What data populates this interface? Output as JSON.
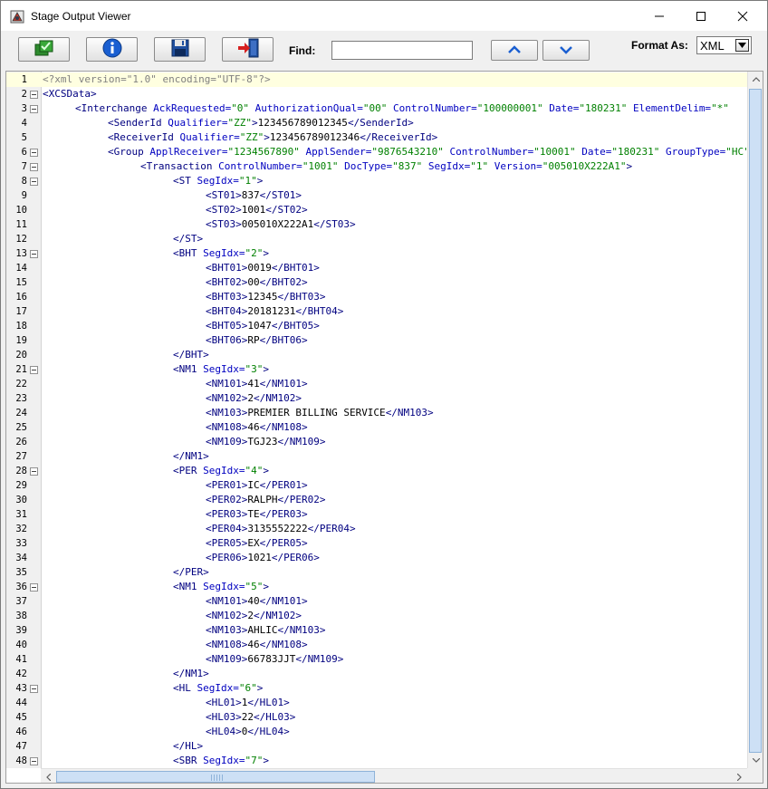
{
  "window": {
    "title": "Stage Output Viewer",
    "icon": "app-icon",
    "controls": [
      "minimize-icon",
      "maximize-icon",
      "close-icon"
    ]
  },
  "toolbar": {
    "buttons": [
      "checkmark-icon",
      "info-icon",
      "save-icon",
      "exit-door-icon"
    ],
    "find_label": "Find:",
    "find_value": "",
    "nav": [
      "up-chevron-icon",
      "down-chevron-icon"
    ],
    "format_label": "Format As:",
    "format_value": "XML"
  },
  "colors": {
    "tag": "#000080",
    "attr": "#0000c0",
    "value": "#008000",
    "decl": "#808080",
    "highlight_line": "#ffffe0",
    "thumb": "#cde0f5"
  },
  "editor": {
    "lines": [
      {
        "n": "1",
        "i": 0,
        "f": false,
        "s": [
          [
            "d",
            "<?xml version=\"1.0\" encoding=\"UTF-8\"?>"
          ]
        ]
      },
      {
        "n": "2",
        "i": 0,
        "f": true,
        "s": [
          [
            "t",
            "<XCSData>"
          ]
        ]
      },
      {
        "n": "3",
        "i": 1,
        "f": true,
        "s": [
          [
            "t",
            "<Interchange "
          ],
          [
            "a",
            "AckRequested="
          ],
          [
            "v",
            "\"0\""
          ],
          [
            "a",
            " AuthorizationQual="
          ],
          [
            "v",
            "\"00\""
          ],
          [
            "a",
            " ControlNumber="
          ],
          [
            "v",
            "\"100000001\""
          ],
          [
            "a",
            " Date="
          ],
          [
            "v",
            "\"180231\""
          ],
          [
            "a",
            " ElementDelim="
          ],
          [
            "v",
            "\"*\""
          ]
        ]
      },
      {
        "n": "4",
        "i": 2,
        "f": false,
        "s": [
          [
            "t",
            "<SenderId "
          ],
          [
            "a",
            "Qualifier="
          ],
          [
            "v",
            "\"ZZ\""
          ],
          [
            "t",
            ">"
          ],
          [
            "x",
            "123456789012345"
          ],
          [
            "t",
            "</SenderId>"
          ]
        ]
      },
      {
        "n": "5",
        "i": 2,
        "f": false,
        "s": [
          [
            "t",
            "<ReceiverId "
          ],
          [
            "a",
            "Qualifier="
          ],
          [
            "v",
            "\"ZZ\""
          ],
          [
            "t",
            ">"
          ],
          [
            "x",
            "123456789012346"
          ],
          [
            "t",
            "</ReceiverId>"
          ]
        ]
      },
      {
        "n": "6",
        "i": 2,
        "f": true,
        "s": [
          [
            "t",
            "<Group "
          ],
          [
            "a",
            "ApplReceiver="
          ],
          [
            "v",
            "\"1234567890\""
          ],
          [
            "a",
            " ApplSender="
          ],
          [
            "v",
            "\"9876543210\""
          ],
          [
            "a",
            " ControlNumber="
          ],
          [
            "v",
            "\"10001\""
          ],
          [
            "a",
            " Date="
          ],
          [
            "v",
            "\"180231\""
          ],
          [
            "a",
            " GroupType="
          ],
          [
            "v",
            "\"HC\""
          ]
        ]
      },
      {
        "n": "7",
        "i": 3,
        "f": true,
        "s": [
          [
            "t",
            "<Transaction "
          ],
          [
            "a",
            "ControlNumber="
          ],
          [
            "v",
            "\"1001\""
          ],
          [
            "a",
            " DocType="
          ],
          [
            "v",
            "\"837\""
          ],
          [
            "a",
            " SegIdx="
          ],
          [
            "v",
            "\"1\""
          ],
          [
            "a",
            " Version="
          ],
          [
            "v",
            "\"005010X222A1\""
          ],
          [
            "t",
            ">"
          ]
        ]
      },
      {
        "n": "8",
        "i": 4,
        "f": true,
        "s": [
          [
            "t",
            "<ST "
          ],
          [
            "a",
            "SegIdx="
          ],
          [
            "v",
            "\"1\""
          ],
          [
            "t",
            ">"
          ]
        ]
      },
      {
        "n": "9",
        "i": 5,
        "f": false,
        "s": [
          [
            "t",
            "<ST01>"
          ],
          [
            "x",
            "837"
          ],
          [
            "t",
            "</ST01>"
          ]
        ]
      },
      {
        "n": "10",
        "i": 5,
        "f": false,
        "s": [
          [
            "t",
            "<ST02>"
          ],
          [
            "x",
            "1001"
          ],
          [
            "t",
            "</ST02>"
          ]
        ]
      },
      {
        "n": "11",
        "i": 5,
        "f": false,
        "s": [
          [
            "t",
            "<ST03>"
          ],
          [
            "x",
            "005010X222A1"
          ],
          [
            "t",
            "</ST03>"
          ]
        ]
      },
      {
        "n": "12",
        "i": 4,
        "f": false,
        "s": [
          [
            "t",
            "</ST>"
          ]
        ]
      },
      {
        "n": "13",
        "i": 4,
        "f": true,
        "s": [
          [
            "t",
            "<BHT "
          ],
          [
            "a",
            "SegIdx="
          ],
          [
            "v",
            "\"2\""
          ],
          [
            "t",
            ">"
          ]
        ]
      },
      {
        "n": "14",
        "i": 5,
        "f": false,
        "s": [
          [
            "t",
            "<BHT01>"
          ],
          [
            "x",
            "0019"
          ],
          [
            "t",
            "</BHT01>"
          ]
        ]
      },
      {
        "n": "15",
        "i": 5,
        "f": false,
        "s": [
          [
            "t",
            "<BHT02>"
          ],
          [
            "x",
            "00"
          ],
          [
            "t",
            "</BHT02>"
          ]
        ]
      },
      {
        "n": "16",
        "i": 5,
        "f": false,
        "s": [
          [
            "t",
            "<BHT03>"
          ],
          [
            "x",
            "12345"
          ],
          [
            "t",
            "</BHT03>"
          ]
        ]
      },
      {
        "n": "17",
        "i": 5,
        "f": false,
        "s": [
          [
            "t",
            "<BHT04>"
          ],
          [
            "x",
            "20181231"
          ],
          [
            "t",
            "</BHT04>"
          ]
        ]
      },
      {
        "n": "18",
        "i": 5,
        "f": false,
        "s": [
          [
            "t",
            "<BHT05>"
          ],
          [
            "x",
            "1047"
          ],
          [
            "t",
            "</BHT05>"
          ]
        ]
      },
      {
        "n": "19",
        "i": 5,
        "f": false,
        "s": [
          [
            "t",
            "<BHT06>"
          ],
          [
            "x",
            "RP"
          ],
          [
            "t",
            "</BHT06>"
          ]
        ]
      },
      {
        "n": "20",
        "i": 4,
        "f": false,
        "s": [
          [
            "t",
            "</BHT>"
          ]
        ]
      },
      {
        "n": "21",
        "i": 4,
        "f": true,
        "s": [
          [
            "t",
            "<NM1 "
          ],
          [
            "a",
            "SegIdx="
          ],
          [
            "v",
            "\"3\""
          ],
          [
            "t",
            ">"
          ]
        ]
      },
      {
        "n": "22",
        "i": 5,
        "f": false,
        "s": [
          [
            "t",
            "<NM101>"
          ],
          [
            "x",
            "41"
          ],
          [
            "t",
            "</NM101>"
          ]
        ]
      },
      {
        "n": "23",
        "i": 5,
        "f": false,
        "s": [
          [
            "t",
            "<NM102>"
          ],
          [
            "x",
            "2"
          ],
          [
            "t",
            "</NM102>"
          ]
        ]
      },
      {
        "n": "24",
        "i": 5,
        "f": false,
        "s": [
          [
            "t",
            "<NM103>"
          ],
          [
            "x",
            "PREMIER BILLING SERVICE"
          ],
          [
            "t",
            "</NM103>"
          ]
        ]
      },
      {
        "n": "25",
        "i": 5,
        "f": false,
        "s": [
          [
            "t",
            "<NM108>"
          ],
          [
            "x",
            "46"
          ],
          [
            "t",
            "</NM108>"
          ]
        ]
      },
      {
        "n": "26",
        "i": 5,
        "f": false,
        "s": [
          [
            "t",
            "<NM109>"
          ],
          [
            "x",
            "TGJ23"
          ],
          [
            "t",
            "</NM109>"
          ]
        ]
      },
      {
        "n": "27",
        "i": 4,
        "f": false,
        "s": [
          [
            "t",
            "</NM1>"
          ]
        ]
      },
      {
        "n": "28",
        "i": 4,
        "f": true,
        "s": [
          [
            "t",
            "<PER "
          ],
          [
            "a",
            "SegIdx="
          ],
          [
            "v",
            "\"4\""
          ],
          [
            "t",
            ">"
          ]
        ]
      },
      {
        "n": "29",
        "i": 5,
        "f": false,
        "s": [
          [
            "t",
            "<PER01>"
          ],
          [
            "x",
            "IC"
          ],
          [
            "t",
            "</PER01>"
          ]
        ]
      },
      {
        "n": "30",
        "i": 5,
        "f": false,
        "s": [
          [
            "t",
            "<PER02>"
          ],
          [
            "x",
            "RALPH"
          ],
          [
            "t",
            "</PER02>"
          ]
        ]
      },
      {
        "n": "31",
        "i": 5,
        "f": false,
        "s": [
          [
            "t",
            "<PER03>"
          ],
          [
            "x",
            "TE"
          ],
          [
            "t",
            "</PER03>"
          ]
        ]
      },
      {
        "n": "32",
        "i": 5,
        "f": false,
        "s": [
          [
            "t",
            "<PER04>"
          ],
          [
            "x",
            "3135552222"
          ],
          [
            "t",
            "</PER04>"
          ]
        ]
      },
      {
        "n": "33",
        "i": 5,
        "f": false,
        "s": [
          [
            "t",
            "<PER05>"
          ],
          [
            "x",
            "EX"
          ],
          [
            "t",
            "</PER05>"
          ]
        ]
      },
      {
        "n": "34",
        "i": 5,
        "f": false,
        "s": [
          [
            "t",
            "<PER06>"
          ],
          [
            "x",
            "1021"
          ],
          [
            "t",
            "</PER06>"
          ]
        ]
      },
      {
        "n": "35",
        "i": 4,
        "f": false,
        "s": [
          [
            "t",
            "</PER>"
          ]
        ]
      },
      {
        "n": "36",
        "i": 4,
        "f": true,
        "s": [
          [
            "t",
            "<NM1 "
          ],
          [
            "a",
            "SegIdx="
          ],
          [
            "v",
            "\"5\""
          ],
          [
            "t",
            ">"
          ]
        ]
      },
      {
        "n": "37",
        "i": 5,
        "f": false,
        "s": [
          [
            "t",
            "<NM101>"
          ],
          [
            "x",
            "40"
          ],
          [
            "t",
            "</NM101>"
          ]
        ]
      },
      {
        "n": "38",
        "i": 5,
        "f": false,
        "s": [
          [
            "t",
            "<NM102>"
          ],
          [
            "x",
            "2"
          ],
          [
            "t",
            "</NM102>"
          ]
        ]
      },
      {
        "n": "39",
        "i": 5,
        "f": false,
        "s": [
          [
            "t",
            "<NM103>"
          ],
          [
            "x",
            "AHLIC"
          ],
          [
            "t",
            "</NM103>"
          ]
        ]
      },
      {
        "n": "40",
        "i": 5,
        "f": false,
        "s": [
          [
            "t",
            "<NM108>"
          ],
          [
            "x",
            "46"
          ],
          [
            "t",
            "</NM108>"
          ]
        ]
      },
      {
        "n": "41",
        "i": 5,
        "f": false,
        "s": [
          [
            "t",
            "<NM109>"
          ],
          [
            "x",
            "66783JJT"
          ],
          [
            "t",
            "</NM109>"
          ]
        ]
      },
      {
        "n": "42",
        "i": 4,
        "f": false,
        "s": [
          [
            "t",
            "</NM1>"
          ]
        ]
      },
      {
        "n": "43",
        "i": 4,
        "f": true,
        "s": [
          [
            "t",
            "<HL "
          ],
          [
            "a",
            "SegIdx="
          ],
          [
            "v",
            "\"6\""
          ],
          [
            "t",
            ">"
          ]
        ]
      },
      {
        "n": "44",
        "i": 5,
        "f": false,
        "s": [
          [
            "t",
            "<HL01>"
          ],
          [
            "x",
            "1"
          ],
          [
            "t",
            "</HL01>"
          ]
        ]
      },
      {
        "n": "45",
        "i": 5,
        "f": false,
        "s": [
          [
            "t",
            "<HL03>"
          ],
          [
            "x",
            "22"
          ],
          [
            "t",
            "</HL03>"
          ]
        ]
      },
      {
        "n": "46",
        "i": 5,
        "f": false,
        "s": [
          [
            "t",
            "<HL04>"
          ],
          [
            "x",
            "0"
          ],
          [
            "t",
            "</HL04>"
          ]
        ]
      },
      {
        "n": "47",
        "i": 4,
        "f": false,
        "s": [
          [
            "t",
            "</HL>"
          ]
        ]
      },
      {
        "n": "48",
        "i": 4,
        "f": true,
        "s": [
          [
            "t",
            "<SBR "
          ],
          [
            "a",
            "SegIdx="
          ],
          [
            "v",
            "\"7\""
          ],
          [
            "t",
            ">"
          ]
        ]
      }
    ]
  }
}
